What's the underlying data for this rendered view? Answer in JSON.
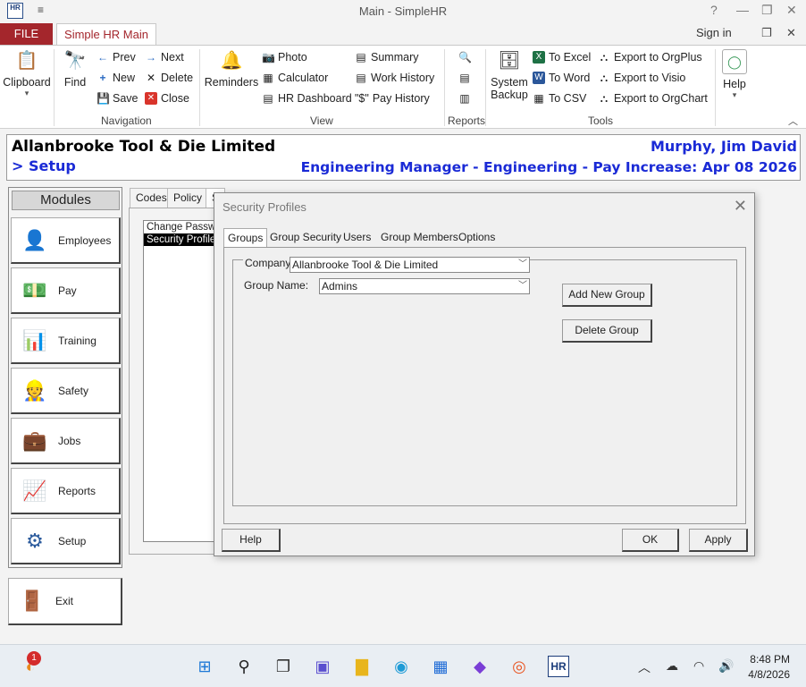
{
  "window": {
    "title": "Main - SimpleHR",
    "app_icon_text": "HR",
    "qat_symbol": "≡",
    "help_symbol": "?",
    "restore_symbol": "❐",
    "close_symbol": "✕"
  },
  "tabs": {
    "file": "FILE",
    "main": "Simple HR Main",
    "sign_in": "Sign in"
  },
  "ribbon": {
    "clipboard": {
      "label": "Clipboard",
      "group": ""
    },
    "navigation": {
      "group": "Navigation",
      "find": "Find",
      "prev": "Prev",
      "next": "Next",
      "new": "New",
      "delete": "Delete",
      "save": "Save",
      "close": "Close"
    },
    "view": {
      "group": "View",
      "reminders": "Reminders",
      "photo": "Photo",
      "calculator": "Calculator",
      "hr_dashboard": "HR Dashboard",
      "summary": "Summary",
      "work_history": "Work History",
      "pay_history": "Pay History",
      "pay_history_icon": "\"$\""
    },
    "reports": {
      "group": "Reports"
    },
    "tools": {
      "group": "Tools",
      "system_backup_1": "System",
      "system_backup_2": "Backup",
      "to_excel": "To Excel",
      "to_word": "To Word",
      "to_csv": "To CSV",
      "export_orgplus": "Export to OrgPlus",
      "export_visio": "Export to Visio",
      "export_orgchart": "Export to OrgChart"
    },
    "help": {
      "label": "Help"
    }
  },
  "header": {
    "company": "Allanbrooke Tool & Die Limited",
    "breadcrumb": "> Setup",
    "employee_name": "Murphy, Jim David",
    "employee_info": "Engineering Manager - Engineering - Pay Increase: Apr 08 2026"
  },
  "modules": {
    "title": "Modules",
    "items": [
      {
        "label": "Employees"
      },
      {
        "label": "Pay"
      },
      {
        "label": "Training"
      },
      {
        "label": "Safety"
      },
      {
        "label": "Jobs"
      },
      {
        "label": "Reports"
      },
      {
        "label": "Setup"
      }
    ],
    "exit": "Exit"
  },
  "setup": {
    "tabs": [
      "Codes",
      "Policy",
      "S"
    ],
    "list": [
      "Change Password",
      "Security Profiles"
    ]
  },
  "dialog": {
    "title": "Security Profiles",
    "tabs": [
      "Groups",
      "Group Security",
      "Users",
      "Group Members",
      "Options"
    ],
    "company_label": "Company:",
    "company_value": "Allanbrooke Tool & Die Limited",
    "group_name_label": "Group Name:",
    "group_name_value": "Admins",
    "add_group": "Add New Group",
    "delete_group": "Delete Group",
    "help": "Help",
    "ok": "OK",
    "apply": "Apply"
  },
  "taskbar": {
    "notification_badge": "1",
    "time": "8:48 PM",
    "date": "4/8/2026"
  },
  "colors": {
    "file_tab": "#a4262c",
    "header_blue": "#1a2ad6"
  }
}
